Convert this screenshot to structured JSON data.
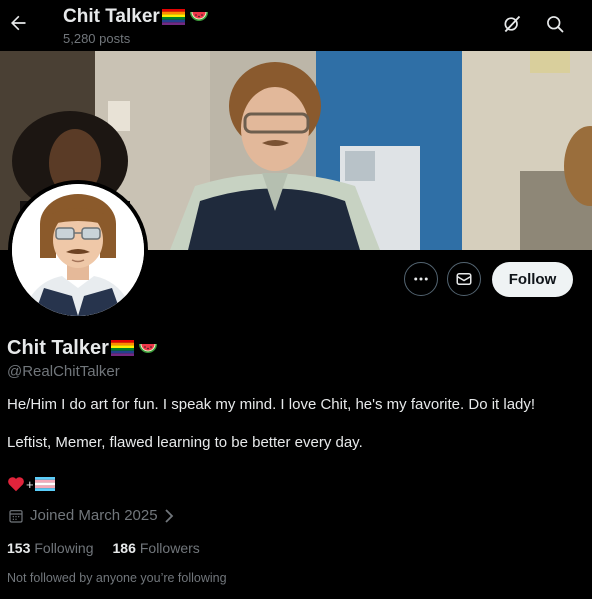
{
  "header": {
    "title": "Chit Talker",
    "posts_count": "5,280 posts"
  },
  "actions": {
    "follow_label": "Follow"
  },
  "profile": {
    "display_name": "Chit Talker",
    "handle": "@RealChitTalker",
    "bio_line1": "He/Him I do art for fun. I speak my mind. I love Chit, he's my favorite. Do it lady!",
    "bio_line2": "Leftist, Memer, flawed learning to be better every day.",
    "bio_plus": "+",
    "joined": "Joined March 2025",
    "following_count": "153",
    "following_label": "Following",
    "followers_count": "186",
    "followers_label": "Followers",
    "followed_note": "Not followed by anyone you’re following"
  },
  "icons": {
    "back": "arrow-left-icon",
    "grok": "grok-icon",
    "search": "search-icon",
    "more": "more-dots-icon",
    "message": "envelope-icon",
    "calendar": "calendar-icon",
    "chevron": "chevron-right-icon",
    "pride_flag": "rainbow-flag-emoji",
    "watermelon": "watermelon-emoji",
    "heart": "red-heart-emoji",
    "trans_flag": "transgender-flag-emoji"
  },
  "colors": {
    "background": "#000000",
    "text": "#e7e9ea",
    "muted": "#71767b",
    "follow_bg": "#eff3f4",
    "follow_text": "#0f1419",
    "border": "#536471"
  }
}
